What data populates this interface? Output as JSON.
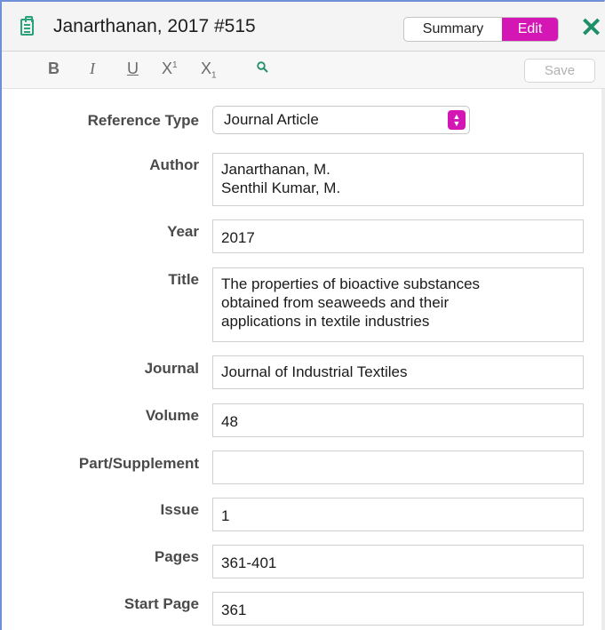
{
  "header": {
    "title": "Janarthanan, 2017 #515",
    "summary_label": "Summary",
    "edit_label": "Edit",
    "close_glyph": "✕",
    "accent": "#d316b4",
    "icon_color": "#2aa37a"
  },
  "toolbar": {
    "bold": "B",
    "italic": "I",
    "underline": "U",
    "superscript_base": "X",
    "superscript_mark": "1",
    "subscript_base": "X",
    "subscript_mark": "1",
    "save_label": "Save",
    "search_icon": "search-icon"
  },
  "form": {
    "reference_type": {
      "label": "Reference Type",
      "value": "Journal Article"
    },
    "author": {
      "label": "Author",
      "value": "Janarthanan, M.\nSenthil Kumar, M."
    },
    "year": {
      "label": "Year",
      "value": "2017"
    },
    "title": {
      "label": "Title",
      "value": "The properties of bioactive substances\nobtained from seaweeds and their\napplications in textile industries"
    },
    "journal": {
      "label": "Journal",
      "value": "Journal of Industrial Textiles"
    },
    "volume": {
      "label": "Volume",
      "value": "48"
    },
    "part_supplement": {
      "label": "Part/Supplement",
      "value": ""
    },
    "issue": {
      "label": "Issue",
      "value": "1"
    },
    "pages": {
      "label": "Pages",
      "value": "361-401"
    },
    "start_page": {
      "label": "Start Page",
      "value": "361"
    }
  }
}
